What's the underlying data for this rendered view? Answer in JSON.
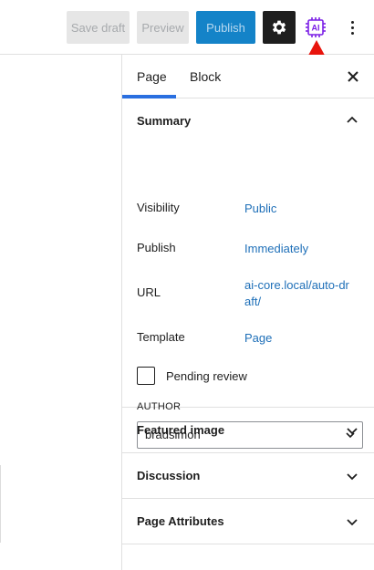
{
  "toolbar": {
    "save_draft": "Save draft",
    "preview": "Preview",
    "publish": "Publish",
    "settings_icon": "gear-icon",
    "ai_label": "AI",
    "more_icon": "more-vertical-icon"
  },
  "sidebar": {
    "tabs": [
      {
        "label": "Page",
        "active": true
      },
      {
        "label": "Block",
        "active": false
      }
    ],
    "summary": {
      "title": "Summary",
      "rows": [
        {
          "label": "Visibility",
          "value": "Public"
        },
        {
          "label": "Publish",
          "value": "Immediately"
        },
        {
          "label": "URL",
          "value": "ai-core.local/auto-draft/"
        },
        {
          "label": "Template",
          "value": "Page"
        }
      ],
      "pending_review": {
        "label": "Pending review",
        "checked": false
      },
      "author": {
        "label": "AUTHOR",
        "value": "bradsimon"
      }
    },
    "panels": [
      {
        "title": "Featured image"
      },
      {
        "title": "Discussion"
      },
      {
        "title": "Page Attributes"
      }
    ]
  },
  "colors": {
    "accent": "#2a6fe0",
    "link": "#1e6fb8",
    "publish_bg": "#1483c8",
    "ai_purple": "#7b1fe6",
    "annotation_red": "#e8140c"
  }
}
